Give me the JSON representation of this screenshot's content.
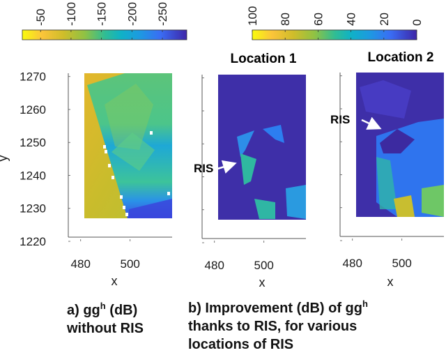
{
  "chart_data": [
    {
      "type": "heatmap",
      "panel": "a",
      "title": "",
      "xlabel": "x",
      "ylabel": "y",
      "xticks": [
        480,
        500
      ],
      "yticks": [
        1220,
        1230,
        1240,
        1250,
        1260,
        1270
      ],
      "xlim": [
        475,
        517
      ],
      "ylim": [
        1220,
        1271
      ],
      "grid": false,
      "colorbar": {
        "orientation": "horizontal",
        "placement": "top",
        "ticks": [
          -50,
          -100,
          -150,
          -200,
          -250
        ],
        "range": [
          -20,
          -290
        ],
        "colormap": "parula"
      },
      "description": "Rotated rectangular building footprint; outside region mostly -60 to -90 dB (yellow/olive), inside region -120 to -250 dB with darker values at lower right"
    },
    {
      "type": "heatmap",
      "panel": "b1",
      "title": "Location 1",
      "xlabel": "x",
      "xticks": [
        480,
        500
      ],
      "yticks": [
        1220,
        1230,
        1240,
        1250,
        1260,
        1270
      ],
      "xlim": [
        475,
        517
      ],
      "ylim": [
        1220,
        1271
      ],
      "grid": false,
      "annotation": "RIS",
      "colorbar": {
        "orientation": "horizontal",
        "placement": "top",
        "ticks": [
          100,
          80,
          60,
          40,
          20,
          0
        ],
        "range": [
          100,
          0
        ],
        "colormap": "parula"
      },
      "description": "Mostly 0 dB improvement; gains of 20-70 dB in patches near RIS on left wall and lower region"
    },
    {
      "type": "heatmap",
      "panel": "b2",
      "title": "Location 2",
      "xlabel": "x",
      "xticks": [
        480,
        500
      ],
      "yticks": [
        1220,
        1230,
        1240,
        1250,
        1260,
        1270
      ],
      "xlim": [
        475,
        517
      ],
      "ylim": [
        1220,
        1271
      ],
      "grid": false,
      "annotation": "RIS",
      "colorbar": {
        "orientation": "horizontal",
        "placement": "top",
        "ticks": [
          100,
          80,
          60,
          40,
          20,
          0
        ],
        "range": [
          100,
          0
        ],
        "colormap": "parula"
      },
      "description": "RIS placed near center; improvements 10-40 dB spread across the building, up to 80-90 dB at bottom"
    }
  ],
  "labels": {
    "colorbar1_ticks": [
      "-50",
      "-100",
      "-150",
      "-200",
      "-250"
    ],
    "colorbar2_ticks": [
      "100",
      "80",
      "60",
      "40",
      "20",
      "0"
    ],
    "yticks": [
      "1270",
      "1260",
      "1250",
      "1240",
      "1230",
      "1220"
    ],
    "xticks": [
      "480",
      "500"
    ],
    "xlabel": "x",
    "ylabel": "y",
    "title_b1": "Location 1",
    "title_b2": "Location 2",
    "ris": "RIS"
  },
  "captions": {
    "a_line1_pre": "a) gg",
    "a_sup": "h",
    "a_line1_post": " (dB)",
    "a_line2": "without RIS",
    "b_line1_pre": "b) Improvement (dB) of gg",
    "b_sup": "h",
    "b_line2": "thanks to RIS, for various",
    "b_line3": "locations of RIS"
  },
  "colors": {
    "parula_stops": [
      "#f9fb0e",
      "#fbbc3d",
      "#cdbd25",
      "#96c140",
      "#2fbc96",
      "#0eb3c4",
      "#1d9ae0",
      "#3a6ff5",
      "#3c46d6",
      "#3e26a8"
    ],
    "background_a_out": "#c8bc2a",
    "background_b": "#3e2fa8",
    "axis": "#555555"
  }
}
